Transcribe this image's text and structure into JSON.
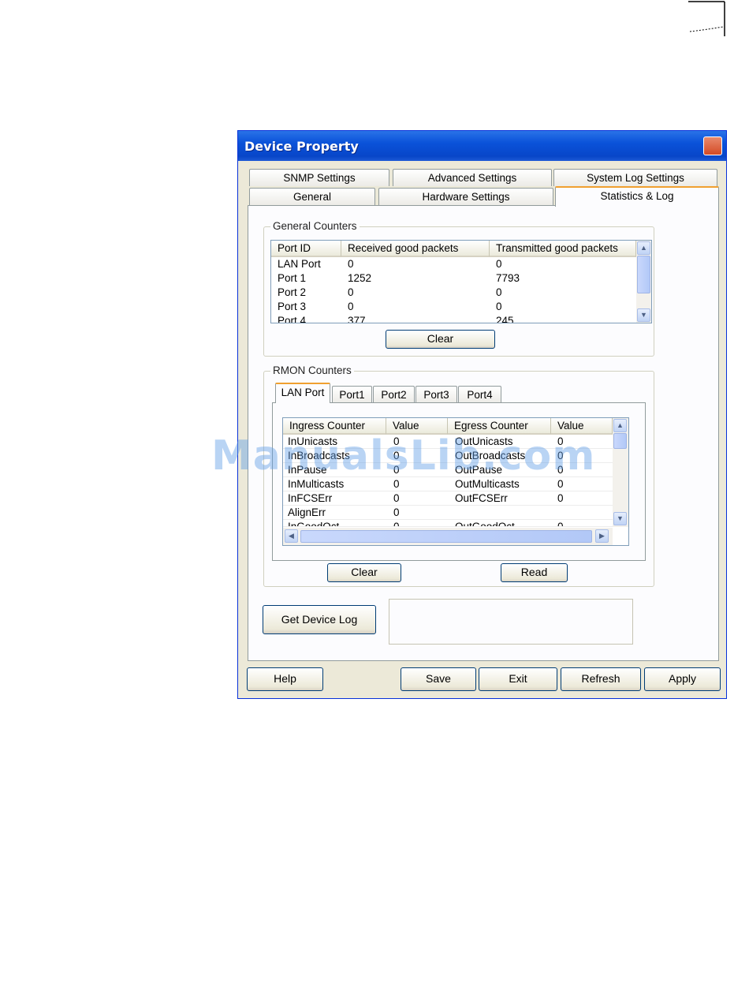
{
  "window": {
    "title": "Device Property",
    "close_glyph": "✕"
  },
  "tabs": {
    "row_back": [
      "SNMP Settings",
      "Advanced Settings",
      "System Log Settings"
    ],
    "row_front": [
      "General",
      "Hardware Settings",
      "Statistics & Log"
    ],
    "active": "Statistics & Log"
  },
  "general_counters": {
    "label": "General Counters",
    "columns": [
      "Port ID",
      "Received good packets",
      "Transmitted good packets"
    ],
    "rows": [
      [
        "LAN Port",
        "0",
        "0"
      ],
      [
        "Port 1",
        "1252",
        "7793"
      ],
      [
        "Port 2",
        "0",
        "0"
      ],
      [
        "Port 3",
        "0",
        "0"
      ],
      [
        "Port 4",
        "377",
        "245"
      ]
    ],
    "clear_label": "Clear"
  },
  "rmon_counters": {
    "label": "RMON Counters",
    "tabs": [
      "LAN Port",
      "Port1",
      "Port2",
      "Port3",
      "Port4"
    ],
    "active_tab": "LAN Port",
    "columns": [
      "Ingress Counter",
      "Value",
      "Egress Counter",
      "Value"
    ],
    "rows": [
      [
        "InUnicasts",
        "0",
        "OutUnicasts",
        "0"
      ],
      [
        "InBroadcasts",
        "0",
        "OutBroadcasts",
        "0"
      ],
      [
        "InPause",
        "0",
        "OutPause",
        "0"
      ],
      [
        "InMulticasts",
        "0",
        "OutMulticasts",
        "0"
      ],
      [
        "InFCSErr",
        "0",
        "OutFCSErr",
        "0"
      ],
      [
        "AlignErr",
        "0",
        "",
        ""
      ],
      [
        "InGoodOct",
        "0",
        "OutGoodOct",
        "0"
      ]
    ],
    "clear_label": "Clear",
    "read_label": "Read"
  },
  "device_log": {
    "button_label": "Get Device Log",
    "value": ""
  },
  "footer": {
    "help": "Help",
    "save": "Save",
    "exit": "Exit",
    "refresh": "Refresh",
    "apply": "Apply"
  },
  "watermark": "ManualsLib.com",
  "icons": {
    "scroll_up": "▲",
    "scroll_down": "▼",
    "scroll_left": "◀",
    "scroll_right": "▶"
  },
  "colors": {
    "title_bar": "#0a52d9",
    "dialog_bg": "#ece9d8",
    "close_button": "#d44a24",
    "active_tab_accent": "#f0a030"
  }
}
